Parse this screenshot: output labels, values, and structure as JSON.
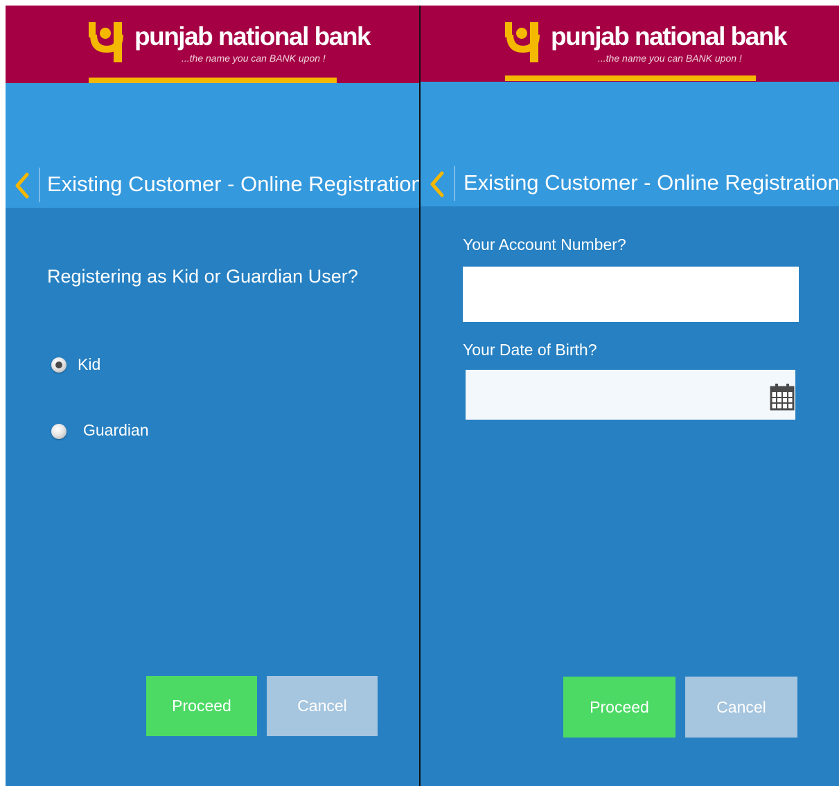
{
  "header": {
    "brand_name": "punjab national bank",
    "tagline": "...the name you can BANK upon !"
  },
  "colors": {
    "header_bg": "#a50044",
    "accent_yellow": "#f5b800",
    "topband_blue": "#3599dd",
    "body_blue": "#2680c2",
    "proceed_green": "#4cd964",
    "cancel_grey_blue": "#a6c5de"
  },
  "icons": {
    "back": "chevron-left-icon",
    "calendar": "calendar-icon",
    "logo": "pnb-logo-icon"
  },
  "left_screen": {
    "title": "Existing Customer - Online Registration",
    "question": "Registering as Kid or Guardian User?",
    "options": [
      {
        "label": "Kid",
        "selected": true
      },
      {
        "label": "Guardian",
        "selected": false
      }
    ],
    "proceed_label": "Proceed",
    "cancel_label": "Cancel"
  },
  "right_screen": {
    "title": "Existing Customer - Online Registration",
    "account_number_label": "Your Account Number?",
    "account_number_value": "",
    "dob_label": "Your Date of Birth?",
    "dob_value": "",
    "proceed_label": "Proceed",
    "cancel_label": "Cancel"
  }
}
